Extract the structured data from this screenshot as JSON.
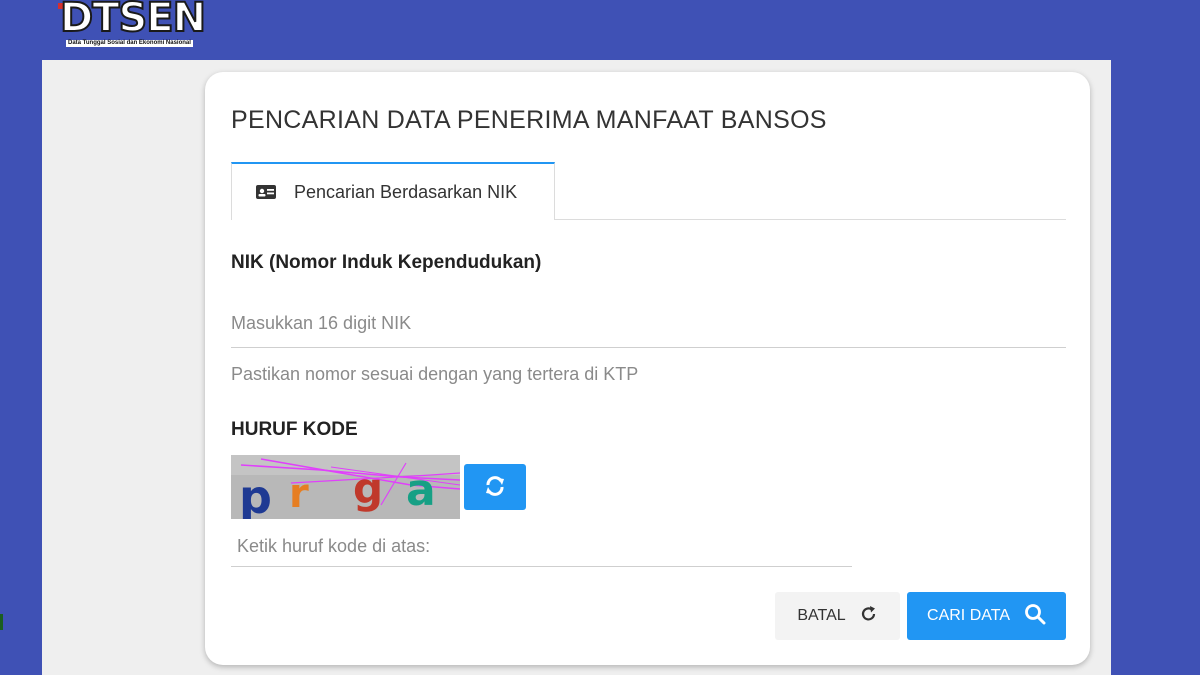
{
  "header": {
    "logo_text": "DTSEN",
    "logo_tagline": "Data Tunggal Sosial dan Ekonomi Nasional"
  },
  "card": {
    "title": "PENCARIAN DATA PENERIMA MANFAAT BANSOS",
    "tab": {
      "label": "Pencarian Berdasarkan NIK",
      "icon": "id-card-icon"
    },
    "nik": {
      "label": "NIK (Nomor Induk Kependudukan)",
      "placeholder": "Masukkan 16 digit NIK",
      "value": "",
      "help": "Pastikan nomor sesuai dengan yang tertera di KTP"
    },
    "kode": {
      "label": "HURUF KODE",
      "captcha_letters": [
        "p",
        "r",
        "g",
        "a"
      ],
      "captcha_colors": [
        "#1f3a93",
        "#e67e22",
        "#c0392b",
        "#16a085"
      ],
      "refresh_icon": "refresh-icon",
      "placeholder": "Ketik huruf kode di atas:",
      "value": ""
    },
    "buttons": {
      "batal_label": "BATAL",
      "batal_icon": "rotate-icon",
      "cari_label": "CARI DATA",
      "cari_icon": "search-icon"
    }
  },
  "colors": {
    "background": "#3f51b5",
    "accent": "#2196f3",
    "card": "#ffffff",
    "content_bg": "#efefef"
  }
}
